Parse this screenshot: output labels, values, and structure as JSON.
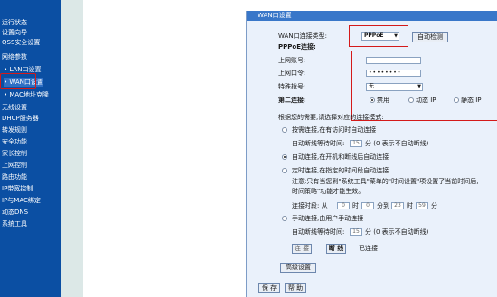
{
  "sidebar": {
    "items": [
      {
        "label": "运行状态"
      },
      {
        "label": "设置向导"
      },
      {
        "label": "QSS安全设置"
      },
      {
        "label": "网络参数"
      },
      {
        "label": "• LAN口设置"
      },
      {
        "label": "• WAN口设置"
      },
      {
        "label": "• MAC地址克隆"
      },
      {
        "label": "无线设置"
      },
      {
        "label": "DHCP服务器"
      },
      {
        "label": "转发规则"
      },
      {
        "label": "安全功能"
      },
      {
        "label": "家长控制"
      },
      {
        "label": "上网控制"
      },
      {
        "label": "路由功能"
      },
      {
        "label": "IP带宽控制"
      },
      {
        "label": "IP与MAC绑定"
      },
      {
        "label": "动态DNS"
      },
      {
        "label": "系统工具"
      }
    ]
  },
  "panel": {
    "title": "WAN口设置",
    "wan_type_label": "WAN口连接类型:",
    "wan_type_value": "PPPoE",
    "auto_detect_button": "自动检测",
    "pppoe_heading": "PPPoE连接:",
    "account_label": "上网账号:",
    "password_label": "上网口令:",
    "password_value": "••••••••",
    "special_dial_label": "特殊拨号:",
    "special_dial_value": "无",
    "second_conn_label": "第二连接:",
    "second_conn_options": [
      "禁用",
      "动态 IP",
      "静态 IP"
    ],
    "mode_prompt": "根据您的需要,请选择对应的连接模式:",
    "on_demand": "按需连接,在有访问时自动连接",
    "idle_label_1": "自动断线等待时间:",
    "idle_value_1": "15",
    "idle_suffix_1": "分 (0 表示不自动断线)",
    "auto_connect": "自动连接,在开机和断线后自动连接",
    "timed_connect": "定时连接,在指定的时间段自动连接",
    "note_line_1": "注意:只有当您到\"系统工具\"菜单的\"时间设置\"项设置了当前时间后,",
    "note_line_2": "时间策略\"功能才能生效。",
    "period_label": "连接时段: 从",
    "period_from_h": "0",
    "period_hour": "时",
    "period_from_m": "0",
    "period_min_to": "分到",
    "period_to_h": "23",
    "period_to_m": "59",
    "period_min": "分",
    "manual_connect": "手动连接,由用户手动连接",
    "idle_label_2": "自动断线等待时间:",
    "idle_value_2": "15",
    "idle_suffix_2": "分 (0 表示不自动断线)",
    "connect_button": "连 接",
    "disconnect_button": "断 线",
    "status_text": "已连接",
    "advanced_button": "高级设置",
    "save_button": "保 存",
    "help_button": "帮 助"
  }
}
